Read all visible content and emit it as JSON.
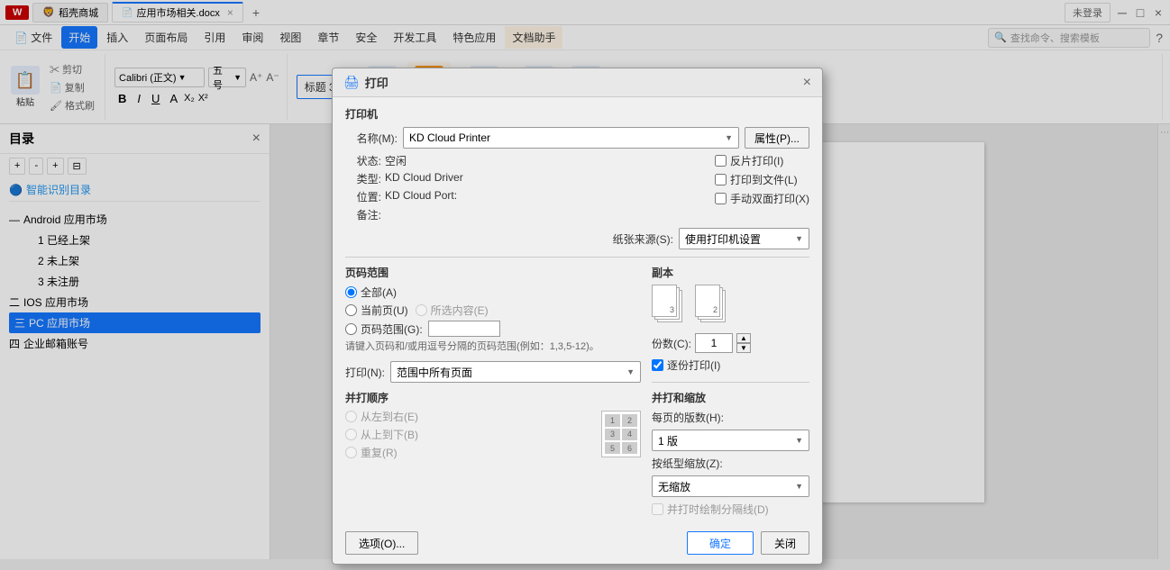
{
  "titlebar": {
    "tabs": [
      {
        "label": "WPS",
        "icon": "W",
        "active": false
      },
      {
        "label": "稻壳商城",
        "active": false
      },
      {
        "label": "应用市场相关.docx",
        "active": true
      }
    ],
    "add_tab": "+",
    "win_controls": [
      "_",
      "□",
      "×"
    ]
  },
  "toolbar": {
    "items": [
      "文件",
      "开始",
      "插入",
      "页面布局",
      "引用",
      "审阅",
      "视图",
      "章节",
      "安全",
      "开发工具",
      "特色应用",
      "文档助手"
    ],
    "start_btn": "开始",
    "search_placeholder": "查找命令、搜索模板"
  },
  "sidebar": {
    "title": "目录",
    "smart_btn": "智能识别目录",
    "tree": [
      {
        "level": 0,
        "label": "Android 应用市场"
      },
      {
        "level": 1,
        "label": "1 已经上架"
      },
      {
        "level": 1,
        "label": "2 未上架"
      },
      {
        "level": 1,
        "label": "3 未注册"
      },
      {
        "level": 0,
        "label": "IOS 应用市场"
      },
      {
        "level": 0,
        "label": "PC 应用市场",
        "selected": true
      },
      {
        "level": 0,
        "label": "企业邮箱账号"
      }
    ]
  },
  "dialog": {
    "title": "打印",
    "title_icon": "🖨",
    "sections": {
      "printer": {
        "label": "打印机",
        "name_label": "名称(M):",
        "name_value": "KD Cloud Printer",
        "props_btn": "属性(P)...",
        "status_label": "状态:",
        "status_value": "空闲",
        "type_label": "类型:",
        "type_value": "KD Cloud Driver",
        "location_label": "位置:",
        "location_value": "KD Cloud Port:",
        "comment_label": "备注:",
        "comment_value": "",
        "checkboxes": {
          "reverse": "反片打印(I)",
          "to_file": "打印到文件(L)",
          "duplex": "手动双面打印(X)"
        },
        "paper_source_label": "纸张来源(S):",
        "paper_source_value": "使用打印机设置"
      },
      "page_range": {
        "title": "页码范围",
        "options": [
          {
            "label": "全部(A)",
            "checked": true
          },
          {
            "label": "当前页(U)",
            "checked": false
          },
          {
            "label": "所选内容(E)",
            "checked": false
          },
          {
            "label": "页码范围(G):",
            "checked": false
          }
        ],
        "range_input": "",
        "hint": "请键入页码和/或用逗号分隔的页码范围(例如：1,3,5-12)。",
        "print_label": "打印(N):",
        "print_value": "范围中所有页面",
        "collate_title": "并打顺序",
        "collate_options": [
          {
            "label": "从左到右(E)",
            "checked": false
          },
          {
            "label": "从上到下(B)",
            "checked": false
          },
          {
            "label": "重复(R)",
            "checked": false
          }
        ],
        "collate_grid_icon": "grid"
      },
      "copies": {
        "title": "副本",
        "copies_label": "份数(C):",
        "copies_value": "1",
        "collate_label": "逐份打印(I)",
        "collate_checked": true
      },
      "scale": {
        "title": "并打和缩放",
        "per_page_label": "每页的版数(H):",
        "per_page_value": "1 版",
        "scale_label": "按纸型缩放(Z):",
        "scale_value": "无缩放",
        "draw_sep_label": "并打时绘制分隔线(D)",
        "draw_sep_disabled": true
      }
    },
    "footer": {
      "options_btn": "选项(O)...",
      "ok_btn": "确定",
      "cancel_btn": "关闭"
    }
  }
}
